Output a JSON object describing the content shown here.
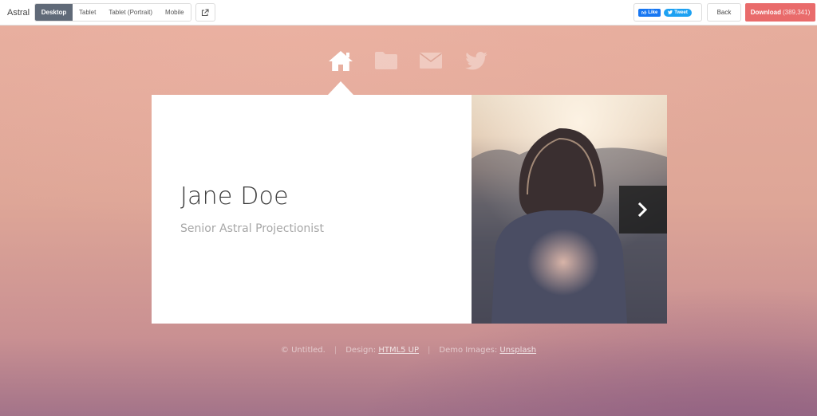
{
  "topbar": {
    "brand": "Astral",
    "devices": [
      "Desktop",
      "Tablet",
      "Tablet (Portrait)",
      "Mobile"
    ],
    "active_device": "Desktop",
    "fb_like": "Like",
    "tweet": "Tweet",
    "back": "Back",
    "download": "Download",
    "download_count": "(389,341)"
  },
  "nav": {
    "items": [
      "home-icon",
      "folder-icon",
      "envelope-icon",
      "twitter-icon"
    ],
    "active": "home-icon"
  },
  "profile": {
    "name": "Jane Doe",
    "title": "Senior Astral Projectionist"
  },
  "footer": {
    "copyright": "© Untitled.",
    "design_label": "Design:",
    "design_link": "HTML5 UP",
    "images_label": "Demo Images:",
    "images_link": "Unsplash"
  },
  "colors": {
    "accent_download": "#e96b6b",
    "active_device_bg": "#606a78",
    "facebook": "#1877f2",
    "twitter": "#1da1f2"
  }
}
